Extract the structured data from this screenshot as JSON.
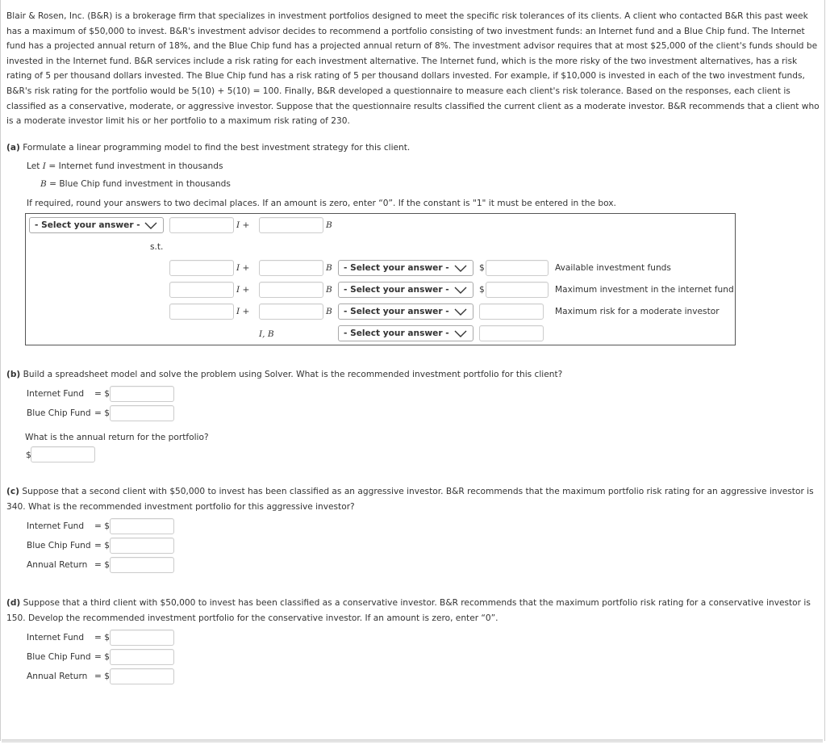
{
  "intro_text": "Blair & Rosen, Inc. (B&R) is a brokerage firm that specializes in investment portfolios designed to meet the specific risk tolerances of its clients. A client who contacted B&R this past week has a maximum of $50,000 to invest. B&R's investment advisor decides to recommend a portfolio consisting of two investment funds: an Internet fund and a Blue Chip fund. The Internet fund has a projected annual return of 18%, and the Blue Chip fund has a projected annual return of 8%. The investment advisor requires that at most $25,000 of the client's funds should be invested in the Internet fund. B&R services include a risk rating for each investment alternative. The Internet fund, which is the more risky of the two investment alternatives, has a risk rating of 5 per thousand dollars invested. The Blue Chip fund has a risk rating of 5 per thousand dollars invested. For example, if $10,000 is invested in each of the two investment funds, B&R's risk rating for the portfolio would be 5(10) + 5(10) = 100. Finally, B&R developed a questionnaire to measure each client's risk tolerance. Based on the responses, each client is classified as a conservative, moderate, or aggressive investor. Suppose that the questionnaire results classified the current client as a moderate investor. B&R recommends that a client who is a moderate investor limit his or her portfolio to a maximum risk rating of 230.",
  "part_a": {
    "label": "(a)",
    "prompt": "Formulate a linear programming model to find the best investment strategy for this client.",
    "let_prefix": "Let ",
    "var_i": "I",
    "var_i_def": " = Internet fund investment in thousands",
    "var_b": "B",
    "var_b_def": " = Blue Chip fund investment in thousands",
    "instructions": "If required, round your answers to two decimal places. If an amount is zero, enter “0”. If the constant is \"1\" it must be entered in the box.",
    "objective": {
      "select_value": "- Select your answer -",
      "coef_i": "",
      "coef_b": "",
      "i_plus": "I +",
      "b_label": "B"
    },
    "st_label": "s.t.",
    "constraints": [
      {
        "coef_i": "",
        "coef_b": "",
        "i_plus": "I +",
        "b_label": "B",
        "relation": "- Select your answer -",
        "currency": "$",
        "rhs": "",
        "description": "Available investment funds"
      },
      {
        "coef_i": "",
        "coef_b": "",
        "i_plus": "I +",
        "b_label": "B",
        "relation": "- Select your answer -",
        "currency": "$",
        "rhs": "",
        "description": "Maximum investment in the internet fund"
      },
      {
        "coef_i": "",
        "coef_b": "",
        "i_plus": "I +",
        "b_label": "B",
        "relation": "- Select your answer -",
        "currency": "",
        "rhs": "",
        "description": "Maximum risk for a moderate investor"
      }
    ],
    "nonneg": {
      "vars_label": "I, B",
      "relation": "- Select your answer -",
      "rhs": ""
    }
  },
  "part_b": {
    "label": "(b)",
    "prompt": "Build a spreadsheet model and solve the problem using Solver. What is the recommended investment portfolio for this client?",
    "internet_label": "Internet Fund",
    "internet_eq": "= $",
    "internet_value": "",
    "bluechip_label": "Blue Chip Fund",
    "bluechip_eq": "= $",
    "bluechip_value": "",
    "return_question": "What is the annual return for the portfolio?",
    "return_currency": "$",
    "return_value": ""
  },
  "part_c": {
    "label": "(c)",
    "prompt": "Suppose that a second client with $50,000 to invest has been classified as an aggressive investor. B&R recommends that the maximum portfolio risk rating for an aggressive investor is 340. What is the recommended investment portfolio for this aggressive investor?",
    "rows": [
      {
        "label": "Internet Fund",
        "eq": "= $",
        "value": ""
      },
      {
        "label": "Blue Chip Fund",
        "eq": "= $",
        "value": ""
      },
      {
        "label": "Annual Return",
        "eq": "= $",
        "value": ""
      }
    ]
  },
  "part_d": {
    "label": "(d)",
    "prompt": "Suppose that a third client with $50,000 to invest has been classified as a conservative investor. B&R recommends that the maximum portfolio risk rating for a conservative investor is 150. Develop the recommended investment portfolio for the conservative investor. If an amount is zero, enter “0”.",
    "rows": [
      {
        "label": "Internet Fund",
        "eq": "= $",
        "value": ""
      },
      {
        "label": "Blue Chip Fund",
        "eq": "= $",
        "value": ""
      },
      {
        "label": "Annual Return",
        "eq": "= $",
        "value": ""
      }
    ]
  }
}
